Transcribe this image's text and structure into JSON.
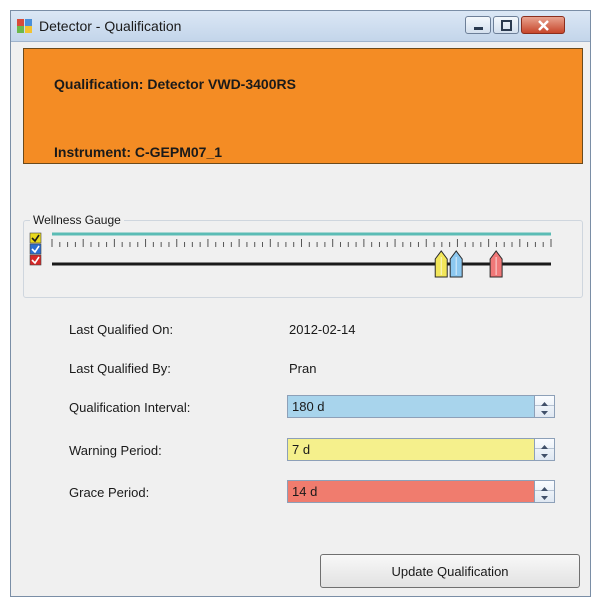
{
  "window": {
    "title": "Detector - Qualification",
    "icon": "qualification-app-icon",
    "controls": [
      "minimize-icon",
      "maximize-icon",
      "close-icon"
    ]
  },
  "banner": {
    "qualification": "Qualification: Detector VWD-3400RS",
    "instrument": "Instrument: C-GEPM07_1",
    "color": "#f48c24"
  },
  "gauge": {
    "legend": "Wellness Gauge",
    "checkboxes": [
      {
        "color": "#e8d81c",
        "checked": true
      },
      {
        "color": "#2c6fd1",
        "checked": true
      },
      {
        "color": "#d62828",
        "checked": true
      }
    ],
    "markers": [
      {
        "name": "warning",
        "color": "#f2e65a",
        "position": 0.78
      },
      {
        "name": "qualification",
        "color": "#8cc8f0",
        "position": 0.81
      },
      {
        "name": "grace",
        "color": "#f07878",
        "position": 0.89
      }
    ],
    "progress_color": "#5bbcb5"
  },
  "info": {
    "last_qualified_on_label": "Last Qualified On:",
    "last_qualified_on_value": "2012-02-14",
    "last_qualified_by_label": "Last Qualified By:",
    "last_qualified_by_value": "Pran"
  },
  "fields": {
    "qualification_interval_label": "Qualification Interval:",
    "qualification_interval_value": "180 d",
    "qualification_interval_color": "#a8d4ec",
    "warning_period_label": "Warning Period:",
    "warning_period_value": "7 d",
    "warning_period_color": "#f5f08c",
    "grace_period_label": "Grace Period:",
    "grace_period_value": "14 d",
    "grace_period_color": "#f07c6e"
  },
  "update_button": "Update Qualification"
}
